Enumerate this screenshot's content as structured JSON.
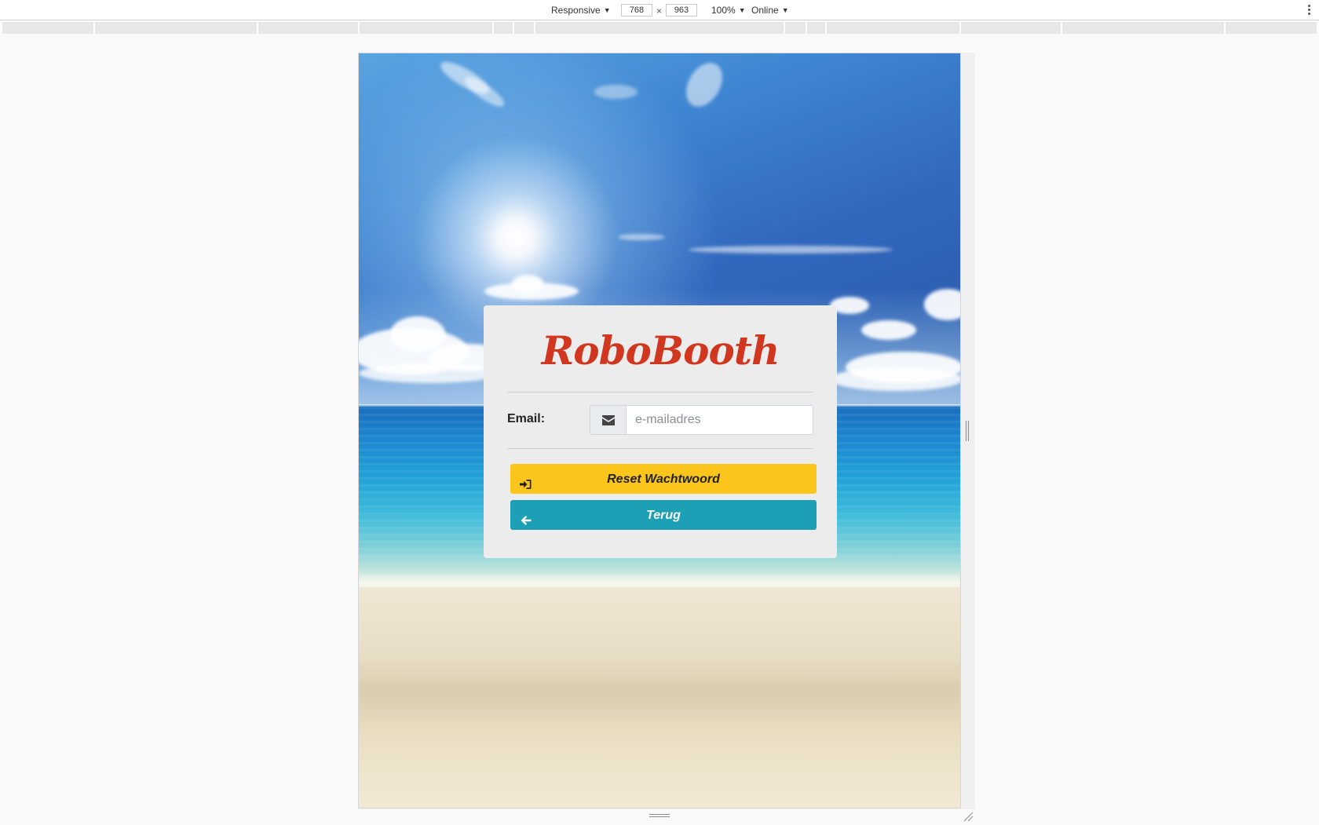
{
  "devtools": {
    "device_mode": "Responsive",
    "width_value": "768",
    "height_value": "963",
    "dimension_separator": "×",
    "zoom": "100%",
    "network": "Online",
    "more_icon": "kebab-icon"
  },
  "login_card": {
    "brand_title": "RoboBooth",
    "email_label": "Email:",
    "email_placeholder": "e-mailadres",
    "email_icon": "envelope-icon",
    "reset_button_label": "Reset Wachtwoord",
    "reset_button_icon": "sign-in-icon",
    "back_button_label": "Terug",
    "back_button_icon": "arrow-left-icon"
  },
  "colors": {
    "brand_red": "#d1361e",
    "reset_button_bg": "#fbc51b",
    "back_button_bg": "#1d9fb5",
    "card_bg": "#ececec"
  }
}
